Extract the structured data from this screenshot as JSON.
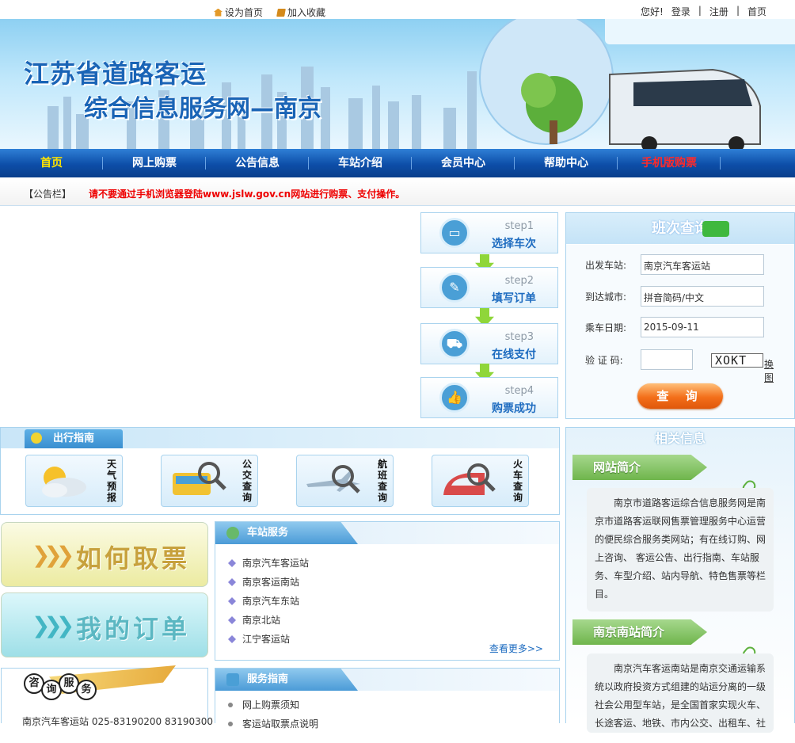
{
  "topbar": {
    "set_home": "设为首页",
    "add_fav": "加入收藏",
    "greeting": "您好!",
    "login": "登录",
    "sep1": "|",
    "register": "注册",
    "sep2": "|",
    "home": "首页"
  },
  "banner": {
    "title_line1": "江苏省道路客运",
    "title_line2": "综合信息服务网—南京"
  },
  "nav": {
    "items": [
      {
        "label": "首页"
      },
      {
        "label": "网上购票"
      },
      {
        "label": "公告信息"
      },
      {
        "label": "车站介绍"
      },
      {
        "label": "会员中心"
      },
      {
        "label": "帮助中心"
      },
      {
        "label": "手机版购票"
      }
    ]
  },
  "notice": {
    "label": "【公告栏】",
    "text": "请不要通过手机浏览器登陆www.jslw.gov.cn网站进行购票、支付操作。"
  },
  "steps": [
    {
      "step": "step1",
      "name": "选择车次",
      "icon": "bus-icon"
    },
    {
      "step": "step2",
      "name": "填写订单",
      "icon": "edit-icon"
    },
    {
      "step": "step3",
      "name": "在线支付",
      "icon": "cart-icon"
    },
    {
      "step": "step4",
      "name": "购票成功",
      "icon": "thumbs-up-icon"
    }
  ],
  "query": {
    "title": "班次查询",
    "depart_label": "出发车站:",
    "depart_value": "南京汽车客运站",
    "arrive_label": "到达城市:",
    "arrive_placeholder": "拼音简码/中文",
    "date_label": "乘车日期:",
    "date_value": "2015-09-11",
    "captcha_label": "验 证 码:",
    "captcha_value": "",
    "captcha_image_text": "XOKT",
    "refresh_captcha": "换图",
    "submit": "查 询"
  },
  "guide": {
    "title": "出行指南",
    "items": [
      {
        "label": "天气预报",
        "icon": "weather-icon"
      },
      {
        "label": "公交查询",
        "icon": "bus-search-icon"
      },
      {
        "label": "航班查询",
        "icon": "flight-search-icon"
      },
      {
        "label": "火车查询",
        "icon": "train-search-icon"
      }
    ]
  },
  "buttons": {
    "how_to_get": "如何取票",
    "my_orders": "我的订单"
  },
  "consult": {
    "chars": [
      "咨",
      "询",
      "服",
      "务"
    ],
    "info": "南京汽车客运站    025-83190200 83190300"
  },
  "station": {
    "title": "车站服务",
    "items": [
      "南京汽车客运站",
      "南京客运南站",
      "南京汽车东站",
      "南京北站",
      "江宁客运站"
    ],
    "more": "查看更多>>"
  },
  "service": {
    "title": "服务指南",
    "items": [
      "网上购票须知",
      "客运站取票点说明"
    ]
  },
  "related": {
    "title": "相关信息",
    "site_title": "网站简介",
    "site_text": "南京市道路客运综合信息服务网是南京市道路客运联网售票管理服务中心运营的便民综合服务类网站；有在线订购、网上咨询、 客运公告、出行指南、车站服务、车型介绍、站内导航、特色售票等栏目。",
    "south_title": "南京南站简介",
    "south_text": "南京汽车客运南站是南京交通运输系统以政府投资方式组建的站运分离的一级社会公用型车站，是全国首家实现火车、长途客运、地铁、市内公交、出租车、社"
  },
  "colors": {
    "nav_bg": "#0d4ea8",
    "accent_blue": "#1e6cc0",
    "notice_red": "#e00000",
    "nav_active": "#ffe400",
    "query_button": "#f36f1a"
  }
}
